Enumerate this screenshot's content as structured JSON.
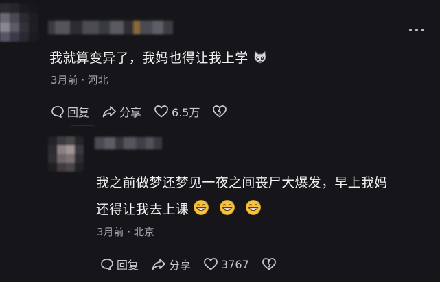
{
  "comment1": {
    "text": "我就算变异了，我妈也得让我上学",
    "emoji": "cat-face-icon",
    "time": "3月前",
    "sep": " · ",
    "location": "河北",
    "actions": {
      "reply_label": "回复",
      "share_label": "分享",
      "like_count": "6.5万"
    }
  },
  "comment2": {
    "text_line1": "我之前做梦还梦见一夜之间丧尸大爆发，早上我妈",
    "text_line2": "还得让我去上课",
    "emojis": [
      "grinning-sweat-icon",
      "grinning-sweat-icon",
      "grinning-sweat-icon"
    ],
    "time": "3月前",
    "sep": " · ",
    "location": "北京",
    "actions": {
      "reply_label": "回复",
      "share_label": "分享",
      "like_count": "3767"
    }
  },
  "colors": {
    "background": "#16161a",
    "text": "#f1f1f4",
    "meta": "#a6a6ad",
    "action": "#c9c9cf"
  },
  "icons": [
    "more-dots-icon",
    "reply-bubble-icon",
    "share-arrow-icon",
    "heart-icon",
    "broken-heart-icon"
  ]
}
